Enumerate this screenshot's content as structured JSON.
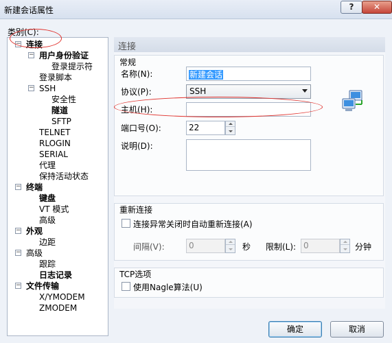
{
  "window": {
    "title": "新建会话属性",
    "help_label": "?",
    "close_label": "✕"
  },
  "category_label": "类别(C):",
  "tree": {
    "items": [
      {
        "label": "连接",
        "bold": true
      },
      {
        "label": "用户身份验证",
        "bold": true
      },
      {
        "label": "登录提示符",
        "bold": false
      },
      {
        "label": "登录脚本",
        "bold": false
      },
      {
        "label": "SSH",
        "bold": false
      },
      {
        "label": "安全性",
        "bold": false
      },
      {
        "label": "隧道",
        "bold": true
      },
      {
        "label": "SFTP",
        "bold": false
      },
      {
        "label": "TELNET",
        "bold": false
      },
      {
        "label": "RLOGIN",
        "bold": false
      },
      {
        "label": "SERIAL",
        "bold": false
      },
      {
        "label": "代理",
        "bold": false
      },
      {
        "label": "保持活动状态",
        "bold": false
      },
      {
        "label": "终端",
        "bold": true
      },
      {
        "label": "键盘",
        "bold": true
      },
      {
        "label": "VT 模式",
        "bold": false
      },
      {
        "label": "高级",
        "bold": false
      },
      {
        "label": "外观",
        "bold": true
      },
      {
        "label": "边距",
        "bold": false
      },
      {
        "label": "高级",
        "bold": false
      },
      {
        "label": "跟踪",
        "bold": false
      },
      {
        "label": "日志记录",
        "bold": true
      },
      {
        "label": "文件传输",
        "bold": true
      },
      {
        "label": "X/YMODEM",
        "bold": false
      },
      {
        "label": "ZMODEM",
        "bold": false
      }
    ],
    "toggle_collapse": "−"
  },
  "panel": {
    "header": "连接",
    "general": {
      "label": "常规",
      "name_label": "名称(N):",
      "name_value": "新建会话",
      "protocol_label": "协议(P):",
      "protocol_value": "SSH",
      "host_label": "主机(H):",
      "host_value": "",
      "port_label": "端口号(O):",
      "port_value": "22",
      "desc_label": "说明(D):",
      "desc_value": ""
    },
    "reconnect": {
      "label": "重新连接",
      "checkbox_label": "连接异常关闭时自动重新连接(A)",
      "interval_label": "间隔(V):",
      "interval_value": "0",
      "seconds_label": "秒",
      "limit_label": "限制(L):",
      "limit_value": "0",
      "minutes_label": "分钟"
    },
    "tcp": {
      "label": "TCP选项",
      "nagle_label": "使用Nagle算法(U)"
    }
  },
  "buttons": {
    "ok": "确定",
    "cancel": "取消"
  },
  "colors": {
    "annotation": "#e0302b",
    "selection": "#3399ff"
  }
}
